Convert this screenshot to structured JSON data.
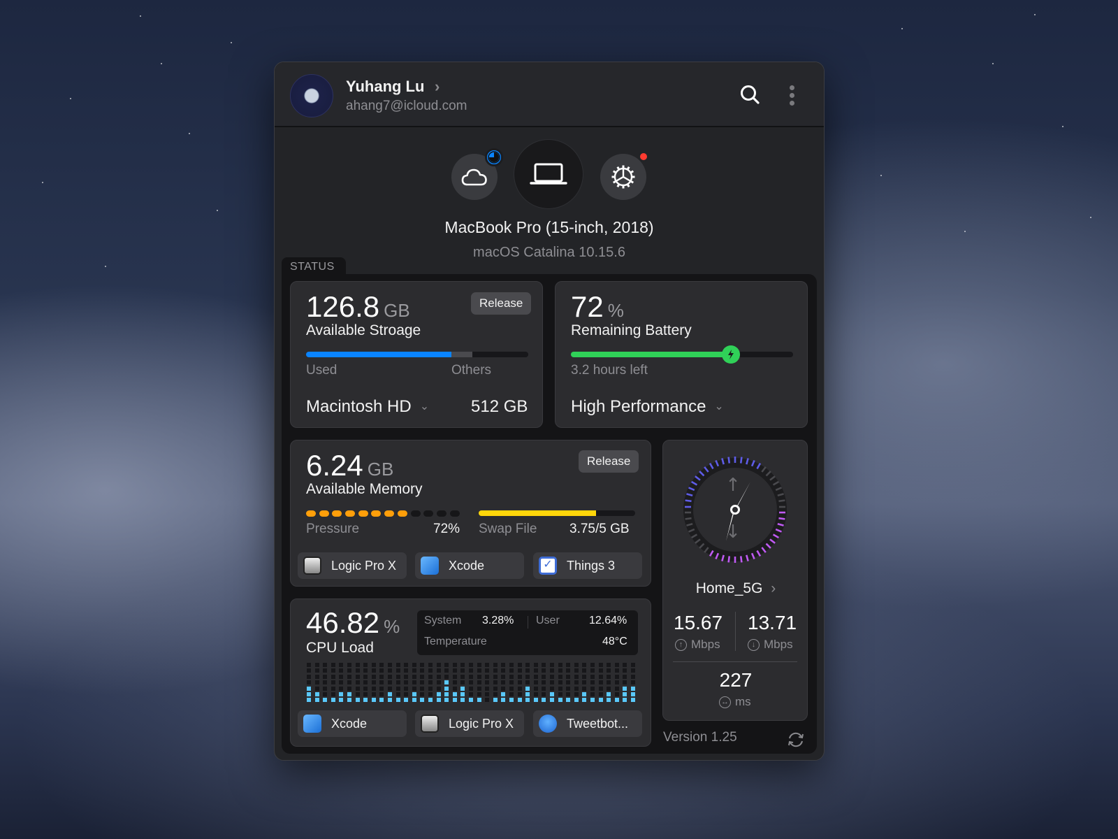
{
  "header": {
    "user_name": "Yuhang Lu",
    "user_email": "ahang7@icloud.com",
    "search_icon": "search-icon",
    "more_icon": "more-vertical-icon"
  },
  "devices": {
    "items": [
      {
        "name": "cloud",
        "icon": "cloud-icon",
        "badge": "sync-progress"
      },
      {
        "name": "laptop",
        "icon": "laptop-icon",
        "selected": true
      },
      {
        "name": "settings",
        "icon": "gear-icon",
        "badge": "notification-dot"
      }
    ],
    "device_name": "MacBook Pro (15-inch, 2018)",
    "os_version": "macOS Catalina 10.15.6"
  },
  "status_tab": "STATUS",
  "storage": {
    "value": "126.8",
    "unit": "GB",
    "label": "Available Stroage",
    "release_label": "Release",
    "used_label": "Used",
    "others_label": "Others",
    "used_fraction": 0.655,
    "others_fraction": 0.095,
    "disk_name": "Macintosh HD",
    "disk_size": "512 GB",
    "colors": {
      "used": "#0a84ff",
      "others": "#4a4a4e"
    }
  },
  "battery": {
    "value": "72",
    "unit": "%",
    "label": "Remaining Battery",
    "level_fraction": 0.72,
    "time_left": "3.2 hours left",
    "mode": "High Performance",
    "color": "#30d158"
  },
  "memory": {
    "value": "6.24",
    "unit": "GB",
    "label": "Available Memory",
    "release_label": "Release",
    "pressure_label": "Pressure",
    "pressure_value": "72%",
    "pressure_dots_total": 12,
    "pressure_dots_on": 8,
    "swap_label": "Swap File",
    "swap_value": "3.75/5 GB",
    "swap_fraction": 0.75,
    "colors": {
      "pressure": "#ff9f0a",
      "swap": "#ffd60a"
    },
    "apps": [
      {
        "name": "Logic Pro X",
        "icon": "logic-pro-icon"
      },
      {
        "name": "Xcode",
        "icon": "xcode-icon"
      },
      {
        "name": "Things 3",
        "icon": "things-icon"
      }
    ]
  },
  "cpu": {
    "value": "46.82",
    "unit": "%",
    "label": "CPU Load",
    "system_label": "System",
    "system_value": "3.28%",
    "user_label": "User",
    "user_value": "12.64%",
    "temp_label": "Temperature",
    "temp_value": "48°C",
    "history_rows": 7,
    "history": [
      3,
      2,
      1,
      1,
      2,
      2,
      1,
      1,
      1,
      1,
      2,
      1,
      1,
      2,
      1,
      1,
      2,
      4,
      2,
      3,
      1,
      1,
      0,
      1,
      2,
      1,
      1,
      3,
      1,
      1,
      2,
      1,
      1,
      1,
      2,
      1,
      1,
      2,
      1,
      3,
      3
    ],
    "color": "#5ac8fa",
    "apps": [
      {
        "name": "Xcode",
        "icon": "xcode-icon"
      },
      {
        "name": "Logic Pro X",
        "icon": "logic-pro-icon"
      },
      {
        "name": "Tweetbot...",
        "icon": "tweetbot-icon"
      }
    ]
  },
  "network": {
    "ssid": "Home_5G",
    "upload_value": "15.67",
    "upload_unit": "Mbps",
    "download_value": "13.71",
    "download_unit": "Mbps",
    "ping_value": "227",
    "ping_unit": "ms",
    "gauge": {
      "upload_fraction": 0.7,
      "download_fraction": 0.68,
      "upload_color": "#5e5ce6",
      "download_color": "#bf5af2"
    }
  },
  "footer": {
    "version": "Version 1.25",
    "refresh_icon": "refresh-icon"
  }
}
